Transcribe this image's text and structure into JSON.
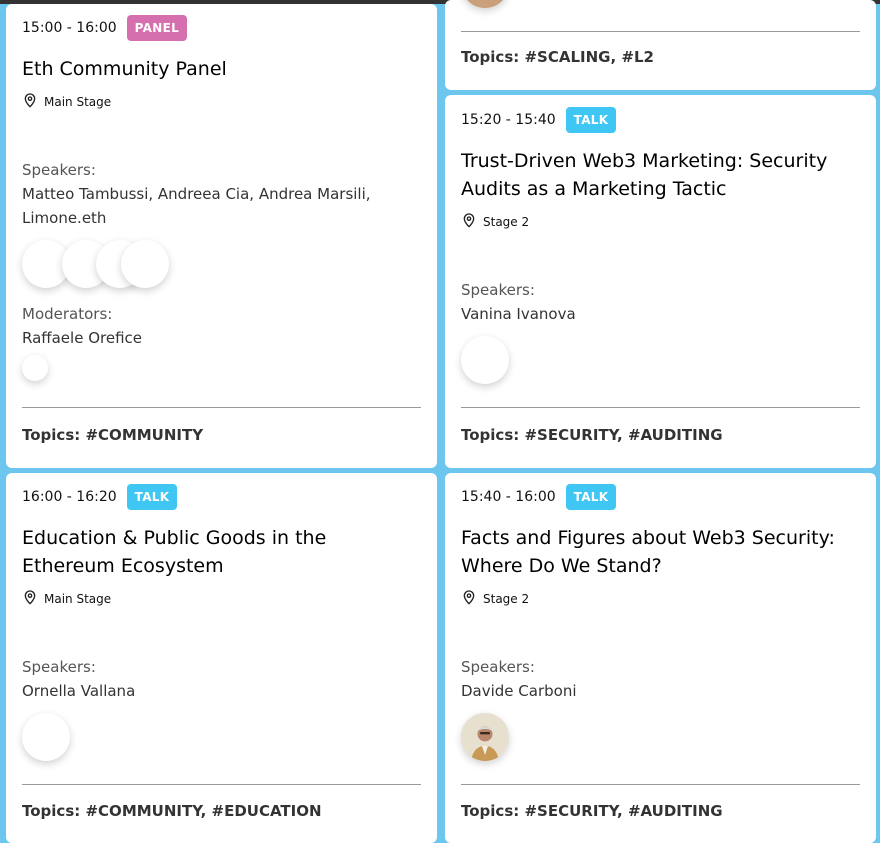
{
  "cards": {
    "top_right": {
      "topics_label": "Topics:",
      "topics": "#SCALING, #L2"
    },
    "panel": {
      "time": "15:00 - 16:00",
      "tag": "PANEL",
      "title": "Eth Community Panel",
      "location": "Main Stage",
      "speakers_label": "Speakers:",
      "speakers": "Matteo Tambussi, Andreea Cia, Andrea Marsili, Limone.eth",
      "moderators_label": "Moderators:",
      "moderators": "Raffaele Orefice",
      "topics_label": "Topics:",
      "topics": "#COMMUNITY"
    },
    "trust": {
      "time": "15:20 - 15:40",
      "tag": "TALK",
      "title": "Trust-Driven Web3 Marketing: Security Audits as a Marketing Tactic",
      "location": "Stage 2",
      "speakers_label": "Speakers:",
      "speakers": "Vanina Ivanova",
      "topics_label": "Topics:",
      "topics": "#SECURITY, #AUDITING"
    },
    "education": {
      "time": "16:00 - 16:20",
      "tag": "TALK",
      "title": "Education & Public Goods in the Ethereum Ecosystem",
      "location": "Main Stage",
      "speakers_label": "Speakers:",
      "speakers": "Ornella Vallana",
      "topics_label": "Topics:",
      "topics": "#COMMUNITY, #EDUCATION"
    },
    "facts": {
      "time": "15:40 - 16:00",
      "tag": "TALK",
      "title": "Facts and Figures about Web3 Security: Where Do We Stand?",
      "location": "Stage 2",
      "speakers_label": "Speakers:",
      "speakers": "Davide Carboni",
      "topics_label": "Topics:",
      "topics": "#SECURITY, #AUDITING"
    }
  },
  "colors": {
    "background": "#6cc6ee",
    "panel_tag": "#d56fae",
    "talk_tag": "#3fc6f2"
  },
  "icons": {
    "location": "map-pin-icon",
    "avatar": "speaker-avatar"
  }
}
